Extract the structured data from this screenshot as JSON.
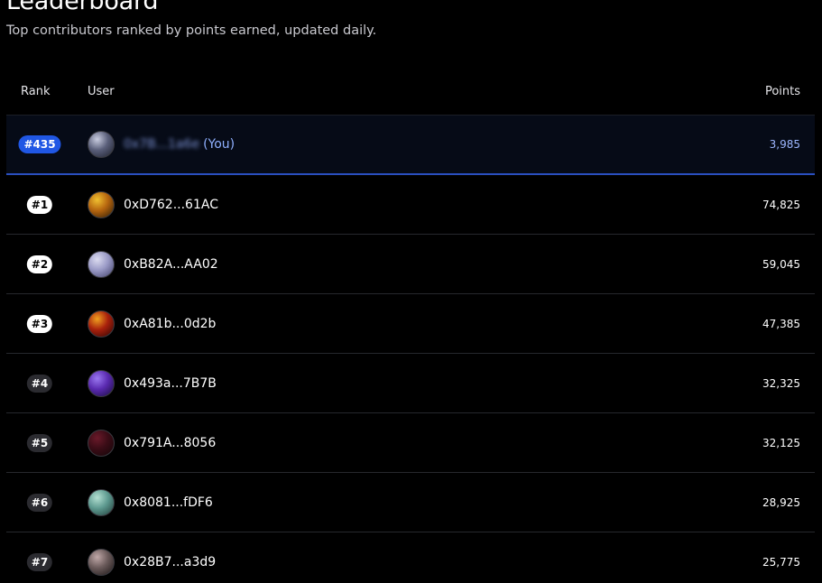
{
  "header": {
    "title": "Leaderboard",
    "subtitle": "Top contributors ranked by points earned, updated daily."
  },
  "table": {
    "columns": {
      "rank": "Rank",
      "user": "User",
      "points": "Points"
    },
    "current_user": {
      "rank": "#435",
      "name_blurred": "0x7B...1a6e",
      "you_label": "(You)",
      "points": "3,985",
      "avatar_colors": [
        "#1b1e2a",
        "#5a5f7a",
        "#c9cde0"
      ]
    },
    "rows": [
      {
        "rank": "#1",
        "user": "0xD762...61AC",
        "points": "74,825",
        "badge": "white",
        "avatar_colors": [
          "#2a1a05",
          "#b5650f",
          "#f0c030"
        ]
      },
      {
        "rank": "#2",
        "user": "0xB82A...AA02",
        "points": "59,045",
        "badge": "white",
        "avatar_colors": [
          "#3e3e66",
          "#9a9ac6",
          "#dcdcf0"
        ]
      },
      {
        "rank": "#3",
        "user": "0xA81b...0d2b",
        "points": "47,385",
        "badge": "white",
        "avatar_colors": [
          "#2a0404",
          "#a8200c",
          "#f0a020"
        ]
      },
      {
        "rank": "#4",
        "user": "0x493a...7B7B",
        "points": "32,325",
        "badge": "dark",
        "avatar_colors": [
          "#160a3a",
          "#5a2ab0",
          "#9a78f0"
        ]
      },
      {
        "rank": "#5",
        "user": "0x791A...8056",
        "points": "32,125",
        "badge": "dark",
        "avatar_colors": [
          "#120608",
          "#3a0c16",
          "#6a1a2a"
        ]
      },
      {
        "rank": "#6",
        "user": "0x8081...fDF6",
        "points": "28,925",
        "badge": "dark",
        "avatar_colors": [
          "#1e3a36",
          "#5e9a90",
          "#b4e0d2"
        ]
      },
      {
        "rank": "#7",
        "user": "0x28B7...a3d9",
        "points": "25,775",
        "badge": "dark",
        "avatar_colors": [
          "#1a1414",
          "#6a5a5a",
          "#c0a8a8"
        ]
      }
    ]
  },
  "colors": {
    "background": "#000000",
    "accent_blue": "#2057e4",
    "you_text": "#8fb0ff",
    "row_divider": "#26282d"
  }
}
